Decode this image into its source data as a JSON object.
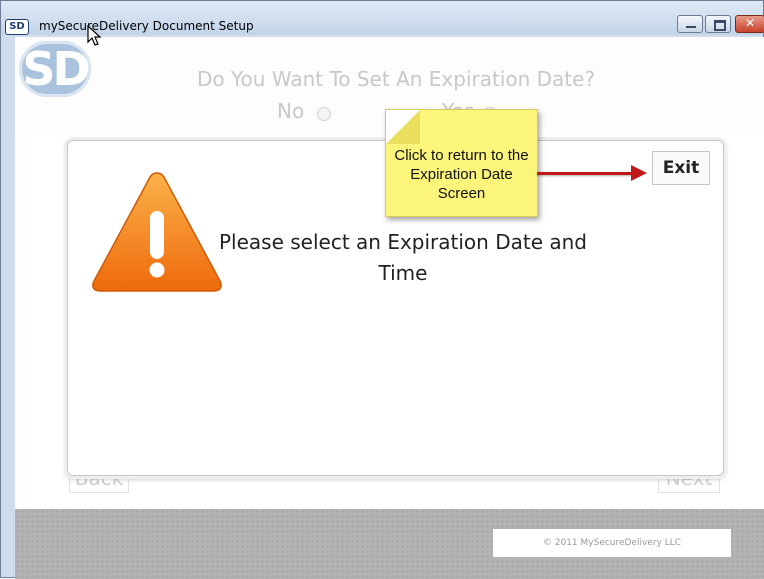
{
  "window": {
    "title": "mySecureDelivery Document Setup",
    "logo_text": "SD"
  },
  "page": {
    "logo_text": "SD",
    "question": "Do You Want To Set An Expiration Date?",
    "option_no": "No",
    "option_yes": "Yes",
    "back_label": "Back",
    "next_label": "Next",
    "copyright": "© 2011 MySecureDelivery LLC"
  },
  "dialog": {
    "message": "Please select an Expiration Date and Time",
    "exit_label": "Exit",
    "icon": "warning-icon"
  },
  "callout": {
    "text": "Click to return to the Expiration Date Screen"
  },
  "colors": {
    "callout_bg": "#fbf57c",
    "arrow": "#c01818",
    "warning_orange": "#f07a12"
  }
}
